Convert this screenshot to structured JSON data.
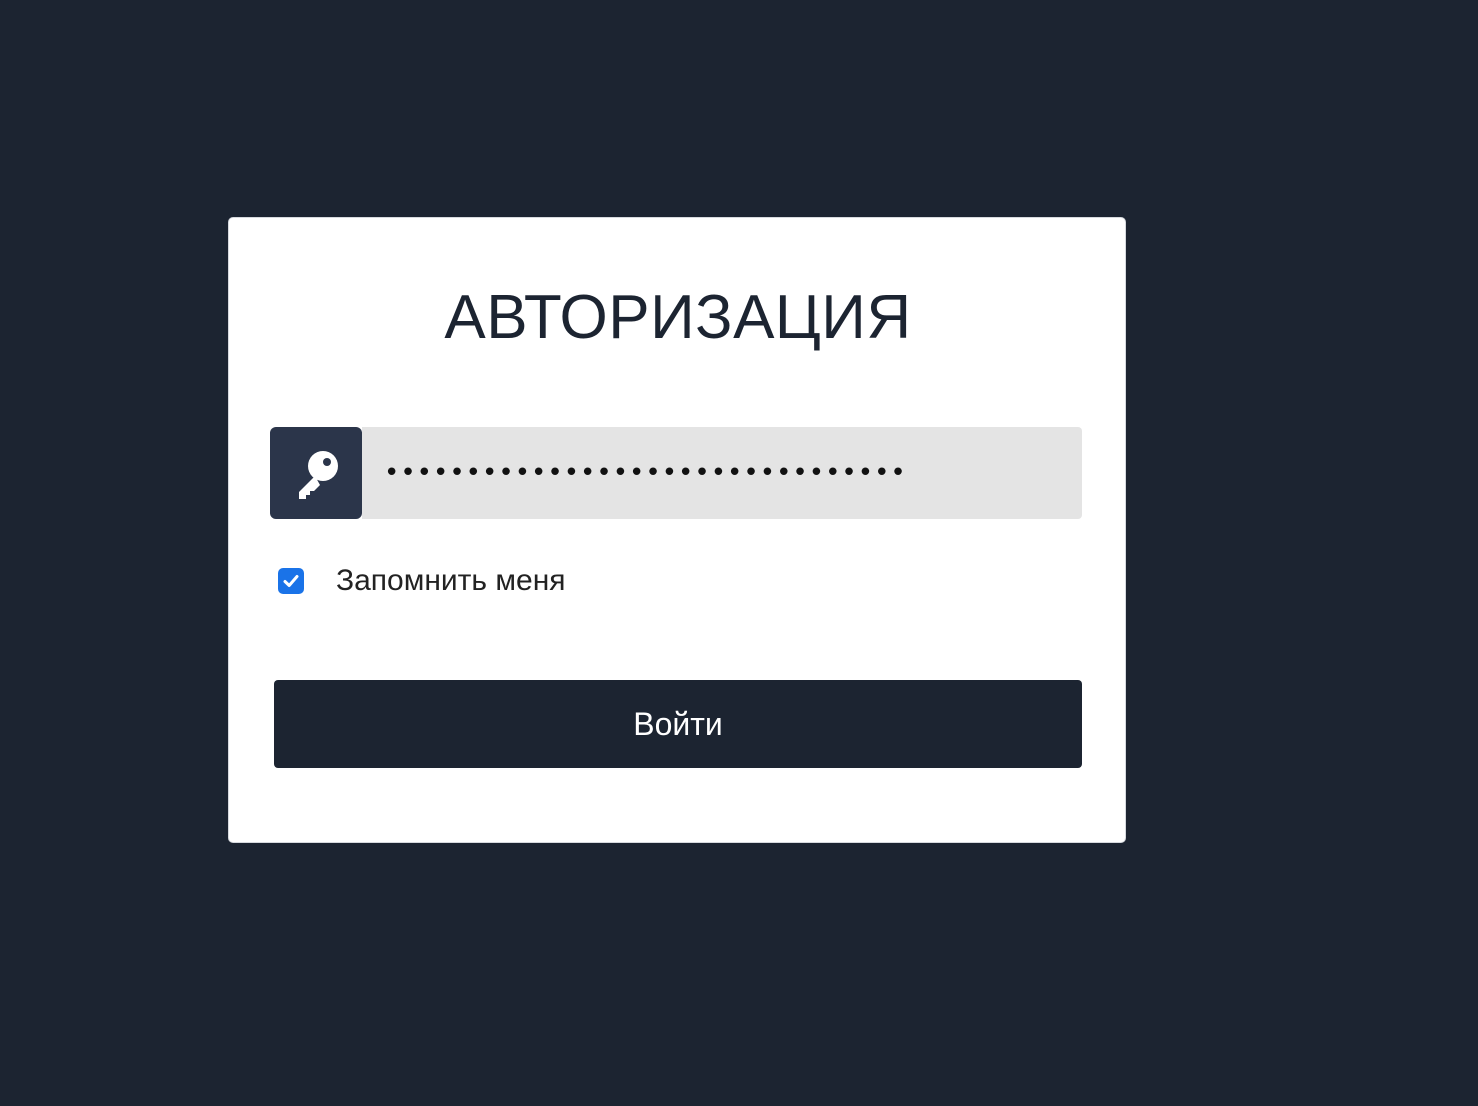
{
  "login": {
    "title": "АВТОРИЗАЦИЯ",
    "password_value": "12345678901234567890123456789012",
    "password_icon": "key-icon",
    "remember_checked": true,
    "remember_label": "Запомнить меня",
    "submit_label": "Войти"
  },
  "colors": {
    "page_background": "#1c2431",
    "card_background": "#ffffff",
    "icon_background": "#2b354a",
    "input_background": "#e4e4e4",
    "checkbox_accent": "#1a73e8",
    "button_background": "#1c2431"
  }
}
